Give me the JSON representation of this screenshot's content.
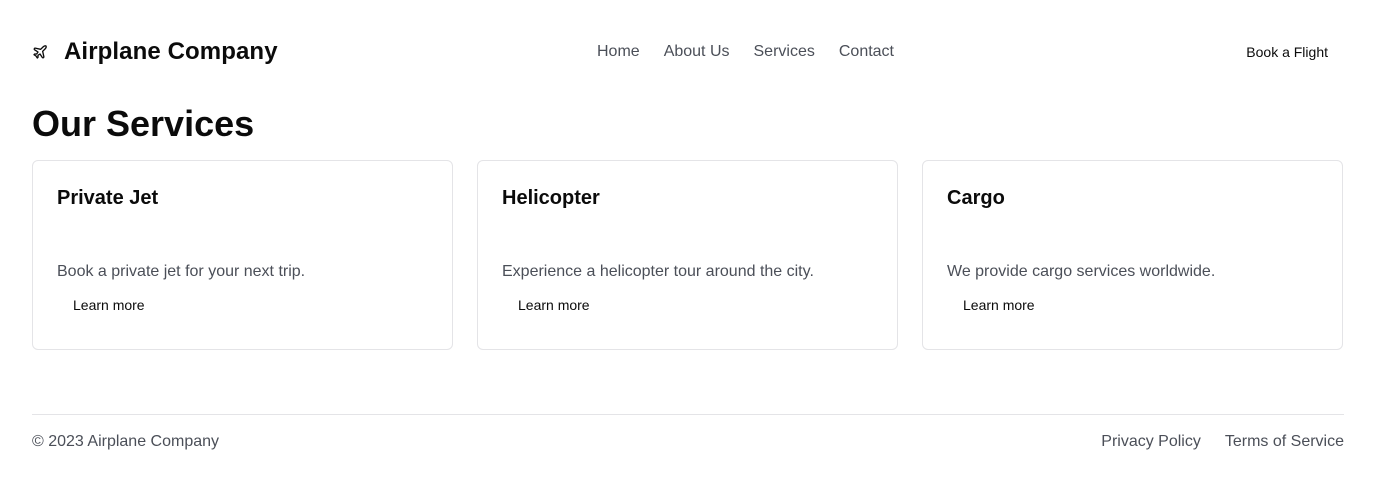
{
  "header": {
    "brand_icon": "airplane-icon",
    "brand_name": "Airplane Company",
    "nav": [
      {
        "label": "Home"
      },
      {
        "label": "About Us"
      },
      {
        "label": "Services"
      },
      {
        "label": "Contact"
      }
    ],
    "cta_label": "Book a Flight"
  },
  "main": {
    "title": "Our Services",
    "cards": [
      {
        "title": "Private Jet",
        "description": "Book a private jet for your next trip.",
        "link_label": "Learn more"
      },
      {
        "title": "Helicopter",
        "description": "Experience a helicopter tour around the city.",
        "link_label": "Learn more"
      },
      {
        "title": "Cargo",
        "description": "We provide cargo services worldwide.",
        "link_label": "Learn more"
      }
    ]
  },
  "footer": {
    "copyright": "© 2023 Airplane Company",
    "links": [
      {
        "label": "Privacy Policy"
      },
      {
        "label": "Terms of Service"
      }
    ]
  },
  "colors": {
    "text_primary": "#0b0b0b",
    "text_muted": "#4b4f58",
    "border": "#e4e4e7",
    "background": "#ffffff"
  }
}
